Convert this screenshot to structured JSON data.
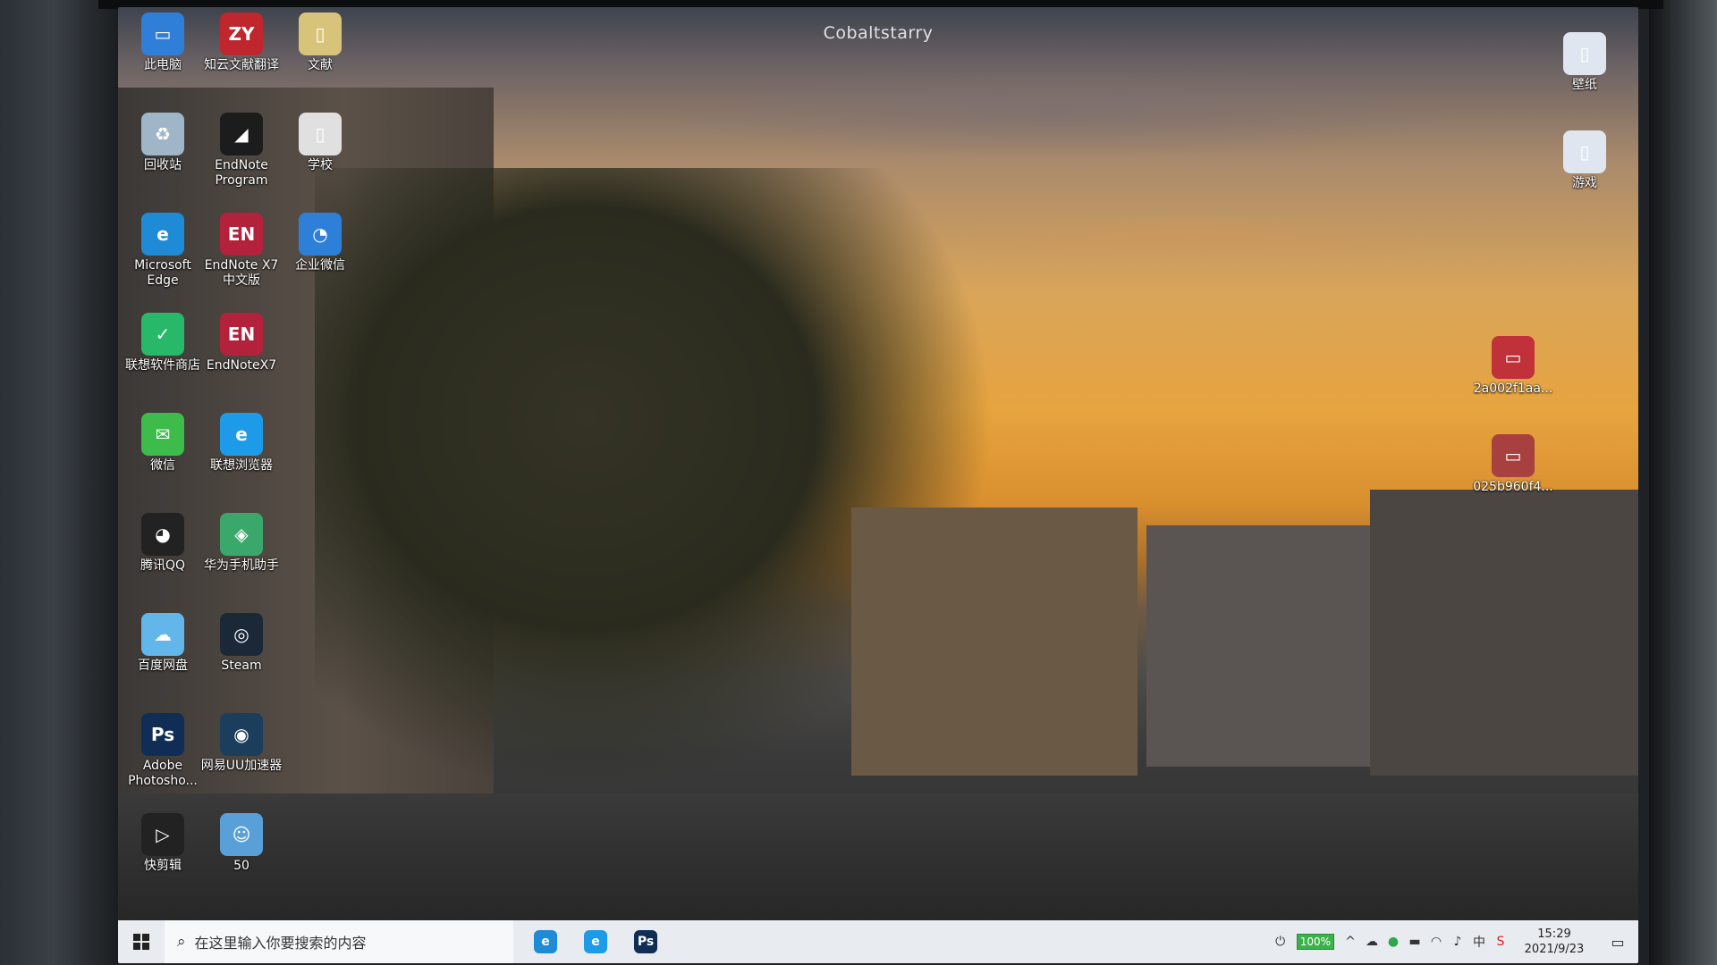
{
  "watermark": "Cobaltstarry",
  "desktop": {
    "icons_left": [
      {
        "label": "此电脑",
        "glyph": "▭",
        "color": "#2f7fd8",
        "name": "this-pc-icon"
      },
      {
        "label": "知云文献翻译",
        "glyph": "ZY",
        "color": "#c0262d",
        "name": "zhiyun-translate-icon"
      },
      {
        "label": "文献",
        "glyph": "▯",
        "color": "#d8c37a",
        "name": "folder-icon"
      },
      {
        "label": "回收站",
        "glyph": "♻",
        "color": "#9fb6c9",
        "name": "recycle-bin-icon"
      },
      {
        "label": "EndNote Program",
        "glyph": "◢",
        "color": "#1c1c1c",
        "name": "endnote-program-icon"
      },
      {
        "label": "学校",
        "glyph": "▯",
        "color": "#e0e0e0",
        "name": "folder-icon"
      },
      {
        "label": "Microsoft Edge",
        "glyph": "e",
        "color": "#1f8ad6",
        "name": "edge-icon"
      },
      {
        "label": "EndNote X7 中文版",
        "glyph": "EN",
        "color": "#b3223a",
        "name": "endnote-x7-cn-icon"
      },
      {
        "label": "企业微信",
        "glyph": "◔",
        "color": "#2d7fd8",
        "name": "wecom-icon"
      },
      {
        "label": "联想软件商店",
        "glyph": "✓",
        "color": "#27b86a",
        "name": "lenovo-store-icon"
      },
      {
        "label": "EndNoteX7",
        "glyph": "EN",
        "color": "#b3223a",
        "name": "endnote-x7-icon"
      },
      {
        "label": "微信",
        "glyph": "✉",
        "color": "#3dbb4b",
        "name": "wechat-icon"
      },
      {
        "label": "联想浏览器",
        "glyph": "e",
        "color": "#1e9be8",
        "name": "lenovo-browser-icon"
      },
      {
        "label": "腾讯QQ",
        "glyph": "◕",
        "color": "#222",
        "name": "qq-icon"
      },
      {
        "label": "华为手机助手",
        "glyph": "◈",
        "color": "#3aa86b",
        "name": "huawei-assistant-icon"
      },
      {
        "label": "百度网盘",
        "glyph": "☁",
        "color": "#62b6ea",
        "name": "baidu-netdisk-icon"
      },
      {
        "label": "Steam",
        "glyph": "◎",
        "color": "#1b2838",
        "name": "steam-icon"
      },
      {
        "label": "Adobe Photosho...",
        "glyph": "Ps",
        "color": "#0f2d55",
        "name": "photoshop-icon"
      },
      {
        "label": "网易UU加速器",
        "glyph": "◉",
        "color": "#1a3e5c",
        "name": "uu-accelerator-icon"
      },
      {
        "label": "快剪辑",
        "glyph": "▷",
        "color": "#222",
        "name": "kuaijianji-icon"
      },
      {
        "label": "50",
        "glyph": "☺",
        "color": "#5aa0d8",
        "name": "file-50-icon"
      }
    ],
    "icons_right": [
      {
        "label": "壁纸",
        "glyph": "▯",
        "color": "#dfe6f0",
        "name": "wallpaper-folder-icon"
      },
      {
        "label": "游戏",
        "glyph": "▯",
        "color": "#dfe6f0",
        "name": "games-folder-icon"
      },
      {
        "label": "2a002f1aa...",
        "glyph": "▭",
        "color": "#c0313a",
        "name": "image-file-icon"
      },
      {
        "label": "025b960f4...",
        "glyph": "▭",
        "color": "#a84040",
        "name": "image-file-icon"
      }
    ]
  },
  "taskbar": {
    "search_placeholder": "在这里输入你要搜索的内容",
    "apps": [
      {
        "name": "edge-taskbar-icon",
        "glyph": "e",
        "color": "#1f8ad6"
      },
      {
        "name": "lenovo-browser-taskbar-icon",
        "glyph": "e",
        "color": "#1e9be8"
      },
      {
        "name": "photoshop-taskbar-icon",
        "glyph": "Ps",
        "color": "#0f2d55"
      }
    ],
    "battery": "100%",
    "time": "15:29",
    "date": "2021/9/23"
  }
}
